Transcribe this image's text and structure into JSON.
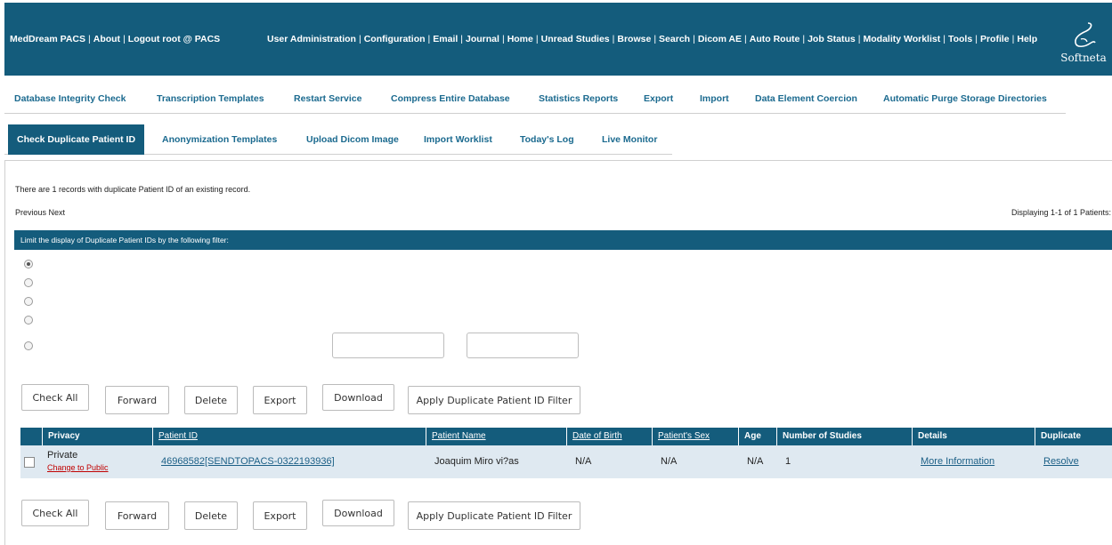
{
  "header": {
    "left_links": [
      "MedDream PACS",
      "About",
      "Logout root @ PACS"
    ],
    "main_links": [
      "User Administration",
      "Configuration",
      "Email",
      "Journal",
      "Home",
      "Unread Studies",
      "Browse",
      "Search",
      "Dicom AE",
      "Auto Route",
      "Job Status",
      "Modality Worklist",
      "Tools",
      "Profile",
      "Help"
    ],
    "separator": "|",
    "logo_text": "Softneta",
    "logo_icon": "softneta-logo-icon"
  },
  "tabs_row1": [
    "Database Integrity Check",
    "Transcription Templates",
    "Restart Service",
    "Compress Entire Database",
    "Statistics Reports",
    "Export",
    "Import",
    "Data Element Coercion",
    "Automatic Purge Storage Directories"
  ],
  "tabs_row2": [
    "Check Duplicate Patient ID",
    "Anonymization Templates",
    "Upload Dicom Image",
    "Import Worklist",
    "Today's Log",
    "Live Monitor"
  ],
  "active_tab": "Check Duplicate Patient ID",
  "content": {
    "message": "There are 1 records with duplicate Patient ID of an existing record.",
    "previous": "Previous",
    "next": "Next",
    "displaying": "Displaying 1-1 of 1 Patients:",
    "filter_title": "Limit the display of Duplicate Patient IDs by the following filter:",
    "filter_selected_index": 0,
    "filter_inputs": [
      "",
      ""
    ]
  },
  "buttons": {
    "check_all": "Check All",
    "forward": "Forward",
    "delete": "Delete",
    "export": "Export",
    "download": "Download",
    "apply_filter": "Apply Duplicate Patient ID Filter"
  },
  "table": {
    "columns": [
      "",
      "Privacy",
      "Patient ID",
      "Patient Name",
      "Date of Birth",
      "Patient's Sex",
      "Age",
      "Number of Studies",
      "Details",
      "Duplicate"
    ],
    "rows": [
      {
        "checked": false,
        "privacy": "Private",
        "privacy_action": "Change to Public",
        "patient_id": "46968582[SENDTOPACS-0322193936]",
        "patient_name": "Joaquim Miro vi?as",
        "date_of_birth": "N/A",
        "sex": "N/A",
        "age": "N/A",
        "num_studies": "1",
        "details": "More Information",
        "duplicate": "Resolve"
      }
    ]
  },
  "colors": {
    "brand": "#145c7c",
    "link": "#1b6a8f",
    "row_bg": "#dfe9f1",
    "warning_link": "#c00000"
  }
}
